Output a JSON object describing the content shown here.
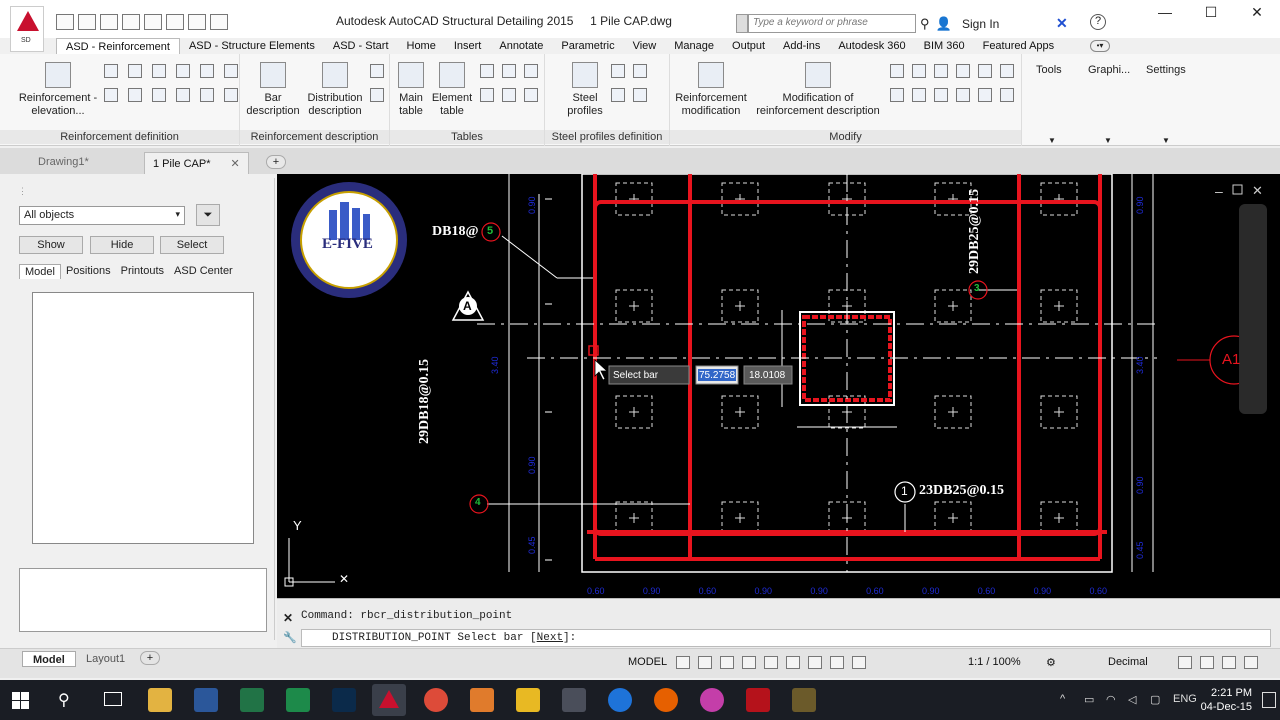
{
  "titlebar": {
    "title": "Autodesk AutoCAD Structural Detailing 2015",
    "filename": "1 Pile CAP.dwg",
    "search_placeholder": "Type a keyword or phrase",
    "signin": "Sign In",
    "app_badge": "SD"
  },
  "ribbon_tabs": [
    "ASD - Reinforcement",
    "ASD - Structure Elements",
    "ASD - Start",
    "Home",
    "Insert",
    "Annotate",
    "Parametric",
    "View",
    "Manage",
    "Output",
    "Add-ins",
    "Autodesk 360",
    "BIM 360",
    "Featured Apps"
  ],
  "ribbon": {
    "reinf_elevation": "Reinforcement -\nelevation...",
    "group_reinf_def": "Reinforcement definition",
    "bar_description": "Bar\ndescription",
    "distribution_description": "Distribution\ndescription",
    "group_reinf_desc": "Reinforcement description",
    "main_table": "Main\ntable",
    "element_table": "Element\ntable",
    "group_tables": "Tables",
    "steel_profiles": "Steel\nprofiles",
    "group_steel": "Steel profiles definition",
    "reinf_modification": "Reinforcement\nmodification",
    "mod_reinf_desc": "Modification of\nreinforcement description",
    "group_modify": "Modify",
    "tools": "Tools",
    "graphics": "Graphi...",
    "settings": "Settings"
  },
  "doc_tabs": [
    {
      "label": "Drawing1*",
      "active": false
    },
    {
      "label": "1 Pile CAP*",
      "active": true
    }
  ],
  "left_panel": {
    "filter_value": "All objects",
    "show": "Show",
    "hide": "Hide",
    "select": "Select",
    "tabs": [
      "Model",
      "Positions",
      "Printouts",
      "ASD Center"
    ]
  },
  "drawing": {
    "logo_text": "E-FIVE",
    "logo_letter": "E",
    "label_db18": "DB18@",
    "label_29db18": "29DB18@0.15",
    "label_29db25": "29DB25@0.15",
    "label_23db25": "23DB25@0.15",
    "marker_5": "5",
    "marker_4": "4",
    "marker_3": "3",
    "marker_1": "1",
    "section_a": "A",
    "section_a1": "A1",
    "tooltip_label": "Select bar",
    "tooltip_x": "75.2758",
    "tooltip_y": "18.0108",
    "ucs_y": "Y",
    "dims_left": [
      "0.90",
      "3.40",
      "0.90",
      "0.45"
    ],
    "dims_right": [
      "0.90",
      "3.40",
      "0.90",
      "0.45"
    ],
    "dims_bottom": [
      "0.60",
      "0.90",
      "0.60",
      "0.90",
      "0.90",
      "0.60",
      "0.90",
      "0.60",
      "0.90",
      "0.60"
    ],
    "colors": {
      "rebar": "#e8141e",
      "dims": "#1f2bd6",
      "lines": "#ffffff",
      "bg": "#000000",
      "marker": "#1fbf3a"
    }
  },
  "command": {
    "history": "Command: rbcr_distribution_point",
    "current_prefix": "DISTRIBUTION_POINT Select bar [",
    "current_option": "Next",
    "current_suffix": "]:"
  },
  "statusbar": {
    "layout_tabs": [
      "Model",
      "Layout1"
    ],
    "model": "MODEL",
    "scale": "1:1 / 100%",
    "units": "Decimal"
  },
  "taskbar": {
    "time": "2:21 PM",
    "date": "04-Dec-15",
    "lang": "ENG"
  }
}
